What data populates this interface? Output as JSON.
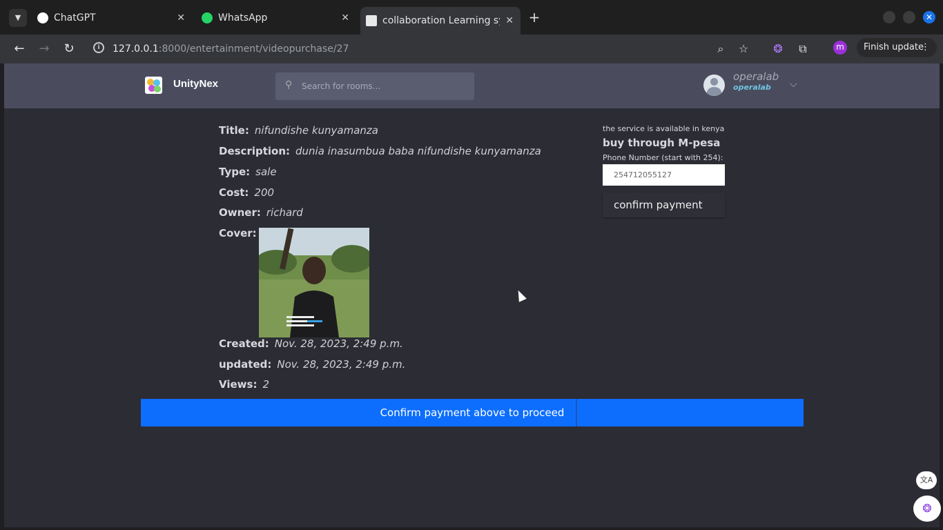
{
  "browser": {
    "tabs": [
      {
        "title": "ChatGPT",
        "icon": "chatgpt-icon"
      },
      {
        "title": "WhatsApp",
        "icon": "whatsapp-icon"
      },
      {
        "title": "collaboration Learning sy",
        "icon": "site-icon"
      }
    ],
    "url_host": "127.0.0.1",
    "url_path": ":8000/entertainment/videopurchase/27",
    "profile_initial": "m",
    "finish_update": "Finish update"
  },
  "header": {
    "brand": "UnityNex",
    "search_placeholder": "Search for rooms...",
    "user_name": "operalab",
    "user_handle": "operalab"
  },
  "details": {
    "title_label": "Title:",
    "title": "nifundishe kunyamanza",
    "description_label": "Description:",
    "description": "dunia inasumbua baba nifundishe kunyamanza",
    "type_label": "Type:",
    "type": "sale",
    "cost_label": "Cost:",
    "cost": "200",
    "owner_label": "Owner:",
    "owner": "richard",
    "cover_label": "Cover:",
    "created_label": "Created:",
    "created": "Nov. 28, 2023, 2:49 p.m.",
    "updated_label": "updated:",
    "updated": "Nov. 28, 2023, 2:49 p.m.",
    "views_label": "Views:",
    "views": "2"
  },
  "payment": {
    "availability": "the service is available in kenya",
    "heading": "buy through M-pesa",
    "phone_label": "Phone Number (start with 254):",
    "phone_value": "254712055127",
    "confirm_button": "confirm payment"
  },
  "proceed_button": "Confirm payment above to proceed",
  "colors": {
    "accent": "#0d6efd",
    "header": "#4a4c5e",
    "background": "#2c2c34"
  }
}
